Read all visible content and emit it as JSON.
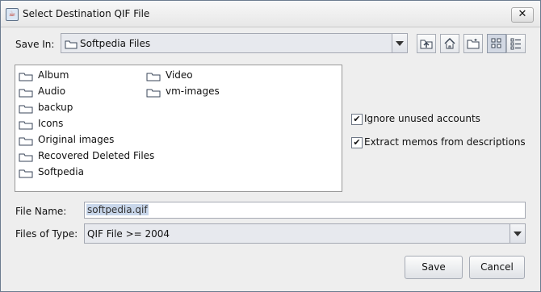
{
  "window": {
    "title": "Select Destination QIF File",
    "close_glyph": "✕"
  },
  "save_in": {
    "label": "Save In:",
    "value": "Softpedia Files"
  },
  "toolbar": {
    "icons": [
      "up-one-level-icon",
      "home-icon",
      "new-folder-icon",
      "list-view-icon",
      "details-view-icon"
    ]
  },
  "files": [
    {
      "name": "Album",
      "icon": "folder-icon"
    },
    {
      "name": "Audio",
      "icon": "folder-icon"
    },
    {
      "name": "backup",
      "icon": "folder-icon"
    },
    {
      "name": "Icons",
      "icon": "folder-icon"
    },
    {
      "name": "Original images",
      "icon": "folder-icon"
    },
    {
      "name": "Recovered Deleted Files",
      "icon": "folder-icon"
    },
    {
      "name": "Softpedia",
      "icon": "folder-icon"
    },
    {
      "name": "Video",
      "icon": "folder-icon"
    },
    {
      "name": "vm-images",
      "icon": "folder-icon"
    }
  ],
  "options": [
    {
      "label": "Ignore unused accounts",
      "checked": true
    },
    {
      "label": "Extract memos from descriptions",
      "checked": true
    }
  ],
  "file_name": {
    "label": "File Name:",
    "value": "softpedia.qif"
  },
  "file_type": {
    "label": "Files of Type:",
    "value": "QIF File >= 2004"
  },
  "buttons": {
    "save": "Save",
    "cancel": "Cancel"
  },
  "colors": {
    "window_background": "#eeeeee",
    "selection": "#c8d6ea"
  }
}
